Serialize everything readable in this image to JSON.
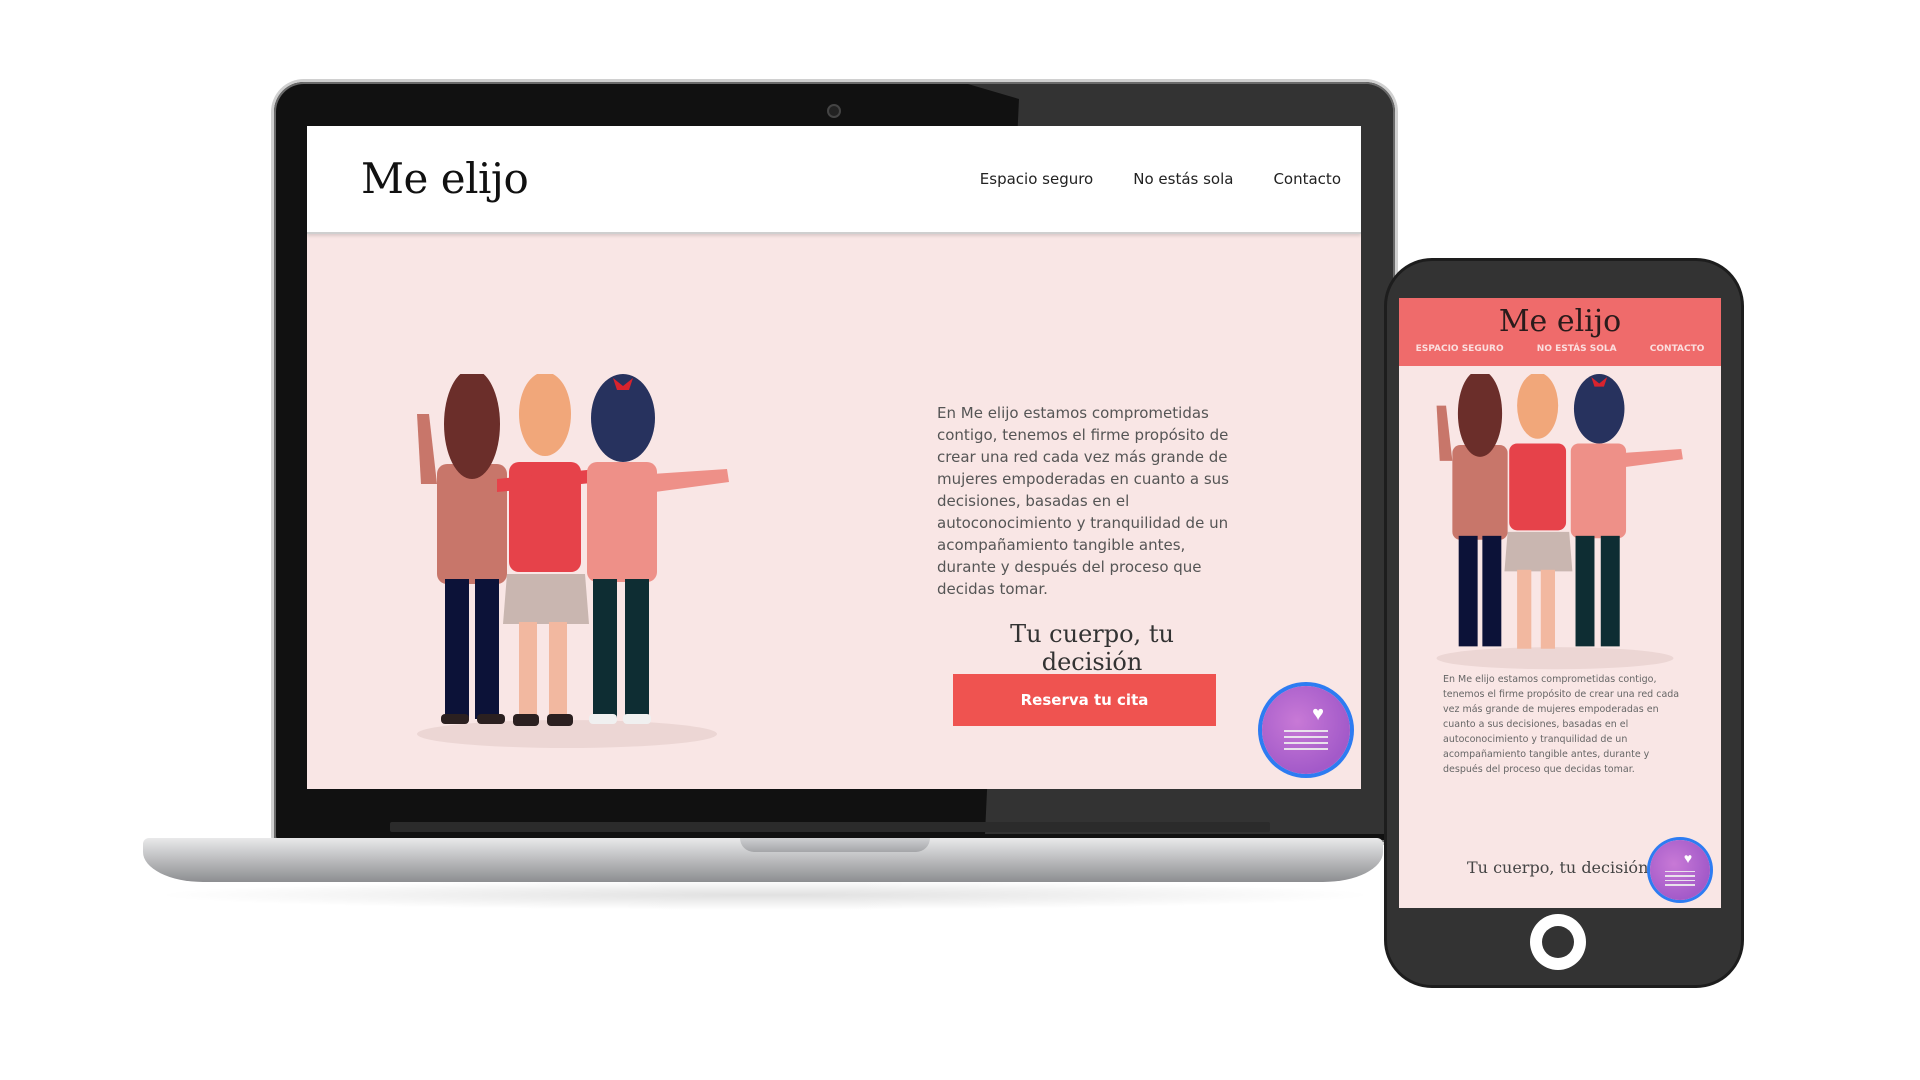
{
  "brand": {
    "logo": "Me elijo",
    "colors": {
      "accent": "#ef5350",
      "hero_bg": "#f9e6e5",
      "mobile_header": "#ef6b6b",
      "fab": "#a35ac9"
    }
  },
  "desktop": {
    "nav": [
      "Espacio seguro",
      "No estás sola",
      "Contacto"
    ],
    "paragraph": "En Me elijo estamos comprometidas contigo, tenemos el firme propósito de crear una red cada vez más grande de mujeres empoderadas en cuanto a sus decisiones, basadas en el autoconocimiento y tranquilidad de un acompañamiento tangible antes, durante y después del proceso que decidas tomar.",
    "tagline": "Tu cuerpo, tu decisión",
    "cta": "Reserva tu cita"
  },
  "mobile": {
    "nav": [
      "ESPACIO SEGURO",
      "NO ESTÁS SOLA",
      "CONTACTO"
    ],
    "paragraph": "En Me elijo estamos comprometidas contigo, tenemos el firme propósito de crear una red cada vez más grande de mujeres empoderadas en cuanto a sus decisiones, basadas en el autoconocimiento y tranquilidad de un acompañamiento tangible antes, durante y después del proceso que decidas tomar.",
    "tagline": "Tu cuerpo, tu decisión"
  },
  "icons": {
    "fab": "chat-heart-icon",
    "illustration": "three-women-illustration"
  }
}
